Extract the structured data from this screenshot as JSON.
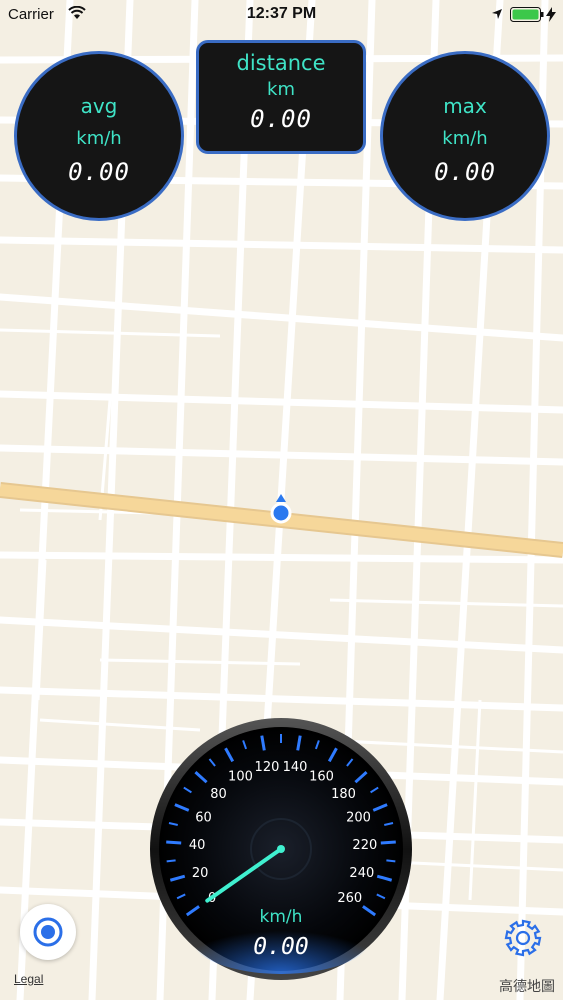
{
  "status_bar": {
    "carrier": "Carrier",
    "time": "12:37 PM"
  },
  "stats": {
    "avg": {
      "label": "avg",
      "unit": "km/h",
      "value": "0.00"
    },
    "distance": {
      "label": "distance",
      "unit": "km",
      "value": "0.00"
    },
    "max": {
      "label": "max",
      "unit": "km/h",
      "value": "0.00"
    }
  },
  "speedometer": {
    "tick_labels": [
      "0",
      "20",
      "40",
      "60",
      "80",
      "100",
      "120",
      "140",
      "160",
      "180",
      "200",
      "220",
      "240",
      "260"
    ],
    "unit": "km/h",
    "value": "0.00",
    "current_speed": 0
  },
  "map": {
    "legal_label": "Legal",
    "credit": "高德地圖"
  },
  "icons": {
    "locate": "locate-icon",
    "settings": "gear-icon",
    "location_marker": "location-marker-icon"
  },
  "colors": {
    "accent": "#3fe3c6",
    "panel_border": "#3a6cc4",
    "gauge_ticks": "#2f7bff",
    "needle": "#40f0d0",
    "map_background": "#f4efe3",
    "main_road": "#f6d79a",
    "location_dot": "#2b79ef"
  }
}
